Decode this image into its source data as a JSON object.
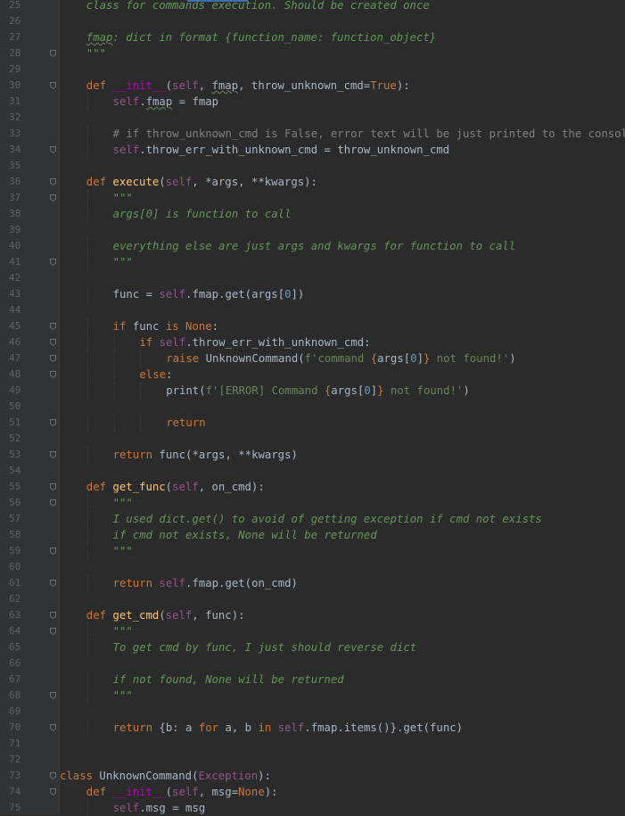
{
  "editor": {
    "language": "python",
    "colors": {
      "background": "#2b2b2b",
      "gutter": "#313335",
      "keyword": "#cc7832",
      "self": "#94558d",
      "function": "#ffc66d",
      "docstring": "#629755",
      "string": "#6a8759",
      "comment": "#808080",
      "text": "#a9b7c6"
    },
    "lines": [
      {
        "n": "25",
        "fold": false,
        "indent": 1,
        "tokens": [
          [
            "doc",
            "class for commands execution. Should be created once"
          ]
        ]
      },
      {
        "n": "26",
        "fold": false,
        "indent": 1,
        "tokens": []
      },
      {
        "n": "27",
        "fold": false,
        "indent": 1,
        "tokens": [
          [
            "docu",
            "fmap"
          ],
          [
            "doc",
            ": dict in format {function_name: function_object}"
          ]
        ]
      },
      {
        "n": "28",
        "fold": true,
        "indent": 1,
        "tokens": [
          [
            "doc",
            "\"\"\""
          ]
        ]
      },
      {
        "n": "29",
        "fold": false,
        "indent": 0,
        "tokens": []
      },
      {
        "n": "30",
        "fold": true,
        "indent": 1,
        "tokens": [
          [
            "kw",
            "def "
          ],
          [
            "magic",
            "__init__"
          ],
          [
            "t",
            "("
          ],
          [
            "self",
            "self"
          ],
          [
            "t",
            ", "
          ],
          [
            "tu",
            "fmap"
          ],
          [
            "t",
            ", throw_unknown_cmd="
          ],
          [
            "kw",
            "True"
          ],
          [
            "t",
            "):"
          ]
        ]
      },
      {
        "n": "31",
        "fold": false,
        "indent": 2,
        "tokens": [
          [
            "self",
            "self"
          ],
          [
            "t",
            "."
          ],
          [
            "tu",
            "fmap"
          ],
          [
            "t",
            " = fmap"
          ]
        ]
      },
      {
        "n": "32",
        "fold": false,
        "indent": 0,
        "tokens": []
      },
      {
        "n": "33",
        "fold": false,
        "indent": 2,
        "tokens": [
          [
            "cmt",
            "# if throw_unknown_cmd is False, error text will be just printed to the console"
          ]
        ]
      },
      {
        "n": "34",
        "fold": true,
        "indent": 2,
        "tokens": [
          [
            "self",
            "self"
          ],
          [
            "t",
            ".throw_err_with_unknown_cmd = throw_unknown_cmd"
          ]
        ]
      },
      {
        "n": "35",
        "fold": false,
        "indent": 0,
        "tokens": []
      },
      {
        "n": "36",
        "fold": true,
        "indent": 1,
        "tokens": [
          [
            "kw",
            "def "
          ],
          [
            "fn",
            "execute"
          ],
          [
            "t",
            "("
          ],
          [
            "self",
            "self"
          ],
          [
            "t",
            ", *args, **kwargs):"
          ]
        ]
      },
      {
        "n": "37",
        "fold": true,
        "indent": 2,
        "tokens": [
          [
            "doc",
            "\"\"\""
          ]
        ]
      },
      {
        "n": "38",
        "fold": false,
        "indent": 2,
        "tokens": [
          [
            "doc",
            "args[0] is function to call"
          ]
        ]
      },
      {
        "n": "39",
        "fold": false,
        "indent": 0,
        "tokens": []
      },
      {
        "n": "40",
        "fold": false,
        "indent": 2,
        "tokens": [
          [
            "doc",
            "everything else are just args and kwargs for function to call"
          ]
        ]
      },
      {
        "n": "41",
        "fold": true,
        "indent": 2,
        "tokens": [
          [
            "doc",
            "\"\"\""
          ]
        ]
      },
      {
        "n": "42",
        "fold": false,
        "indent": 0,
        "tokens": []
      },
      {
        "n": "43",
        "fold": false,
        "indent": 2,
        "tokens": [
          [
            "t",
            "func = "
          ],
          [
            "self",
            "self"
          ],
          [
            "t",
            ".fmap.get(args["
          ],
          [
            "num",
            "0"
          ],
          [
            "t",
            "])"
          ]
        ]
      },
      {
        "n": "44",
        "fold": false,
        "indent": 0,
        "tokens": []
      },
      {
        "n": "45",
        "fold": true,
        "indent": 2,
        "tokens": [
          [
            "kw",
            "if "
          ],
          [
            "t",
            "func "
          ],
          [
            "kw",
            "is None"
          ],
          [
            "t",
            ":"
          ]
        ]
      },
      {
        "n": "46",
        "fold": true,
        "indent": 3,
        "tokens": [
          [
            "kw",
            "if "
          ],
          [
            "self",
            "self"
          ],
          [
            "t",
            ".throw_err_with_unknown_cmd:"
          ]
        ]
      },
      {
        "n": "47",
        "fold": true,
        "indent": 4,
        "tokens": [
          [
            "kw",
            "raise "
          ],
          [
            "t",
            "UnknownCommand("
          ],
          [
            "str",
            "f'command "
          ],
          [
            "kw",
            "{"
          ],
          [
            "t",
            "args["
          ],
          [
            "num",
            "0"
          ],
          [
            "t",
            "]"
          ],
          [
            "kw",
            "}"
          ],
          [
            "str",
            " not found!'"
          ],
          [
            "t",
            ")"
          ]
        ]
      },
      {
        "n": "48",
        "fold": true,
        "indent": 3,
        "tokens": [
          [
            "kw",
            "else"
          ],
          [
            "t",
            ":"
          ]
        ]
      },
      {
        "n": "49",
        "fold": false,
        "indent": 4,
        "tokens": [
          [
            "t",
            "print("
          ],
          [
            "str",
            "f'[ERROR] Command "
          ],
          [
            "kw",
            "{"
          ],
          [
            "t",
            "args["
          ],
          [
            "num",
            "0"
          ],
          [
            "t",
            "]"
          ],
          [
            "kw",
            "}"
          ],
          [
            "str",
            " not found!'"
          ],
          [
            "t",
            ")"
          ]
        ]
      },
      {
        "n": "50",
        "fold": false,
        "indent": 0,
        "tokens": []
      },
      {
        "n": "51",
        "fold": true,
        "indent": 4,
        "tokens": [
          [
            "kw",
            "return"
          ]
        ]
      },
      {
        "n": "52",
        "fold": false,
        "indent": 0,
        "tokens": []
      },
      {
        "n": "53",
        "fold": true,
        "indent": 2,
        "tokens": [
          [
            "kw",
            "return "
          ],
          [
            "t",
            "func(*args, **kwargs)"
          ]
        ]
      },
      {
        "n": "54",
        "fold": false,
        "indent": 0,
        "tokens": []
      },
      {
        "n": "55",
        "fold": true,
        "indent": 1,
        "tokens": [
          [
            "kw",
            "def "
          ],
          [
            "fn",
            "get_func"
          ],
          [
            "t",
            "("
          ],
          [
            "self",
            "self"
          ],
          [
            "t",
            ", on_cmd):"
          ]
        ]
      },
      {
        "n": "56",
        "fold": true,
        "indent": 2,
        "tokens": [
          [
            "doc",
            "\"\"\""
          ]
        ]
      },
      {
        "n": "57",
        "fold": false,
        "indent": 2,
        "tokens": [
          [
            "doc",
            "I used dict.get() to avoid of getting exception if cmd not exists"
          ]
        ]
      },
      {
        "n": "58",
        "fold": false,
        "indent": 2,
        "tokens": [
          [
            "doc",
            "if cmd not exists, None will be returned"
          ]
        ]
      },
      {
        "n": "59",
        "fold": true,
        "indent": 2,
        "tokens": [
          [
            "doc",
            "\"\"\""
          ]
        ]
      },
      {
        "n": "60",
        "fold": false,
        "indent": 0,
        "tokens": []
      },
      {
        "n": "61",
        "fold": true,
        "indent": 2,
        "tokens": [
          [
            "kw",
            "return "
          ],
          [
            "self",
            "self"
          ],
          [
            "t",
            ".fmap.get(on_cmd)"
          ]
        ]
      },
      {
        "n": "62",
        "fold": false,
        "indent": 0,
        "tokens": []
      },
      {
        "n": "63",
        "fold": true,
        "indent": 1,
        "tokens": [
          [
            "kw",
            "def "
          ],
          [
            "fn",
            "get_cmd"
          ],
          [
            "t",
            "("
          ],
          [
            "self",
            "self"
          ],
          [
            "t",
            ", func):"
          ]
        ]
      },
      {
        "n": "64",
        "fold": true,
        "indent": 2,
        "tokens": [
          [
            "doc",
            "\"\"\""
          ]
        ]
      },
      {
        "n": "65",
        "fold": false,
        "indent": 2,
        "tokens": [
          [
            "doc",
            "To get cmd by func, I just should reverse dict"
          ]
        ]
      },
      {
        "n": "66",
        "fold": false,
        "indent": 0,
        "tokens": []
      },
      {
        "n": "67",
        "fold": false,
        "indent": 2,
        "tokens": [
          [
            "doc",
            "if not found, None will be returned"
          ]
        ]
      },
      {
        "n": "68",
        "fold": true,
        "indent": 2,
        "tokens": [
          [
            "doc",
            "\"\"\""
          ]
        ]
      },
      {
        "n": "69",
        "fold": false,
        "indent": 0,
        "tokens": []
      },
      {
        "n": "70",
        "fold": true,
        "indent": 2,
        "tokens": [
          [
            "kw",
            "return "
          ],
          [
            "t",
            "{b: a "
          ],
          [
            "kw",
            "for "
          ],
          [
            "t",
            "a, b "
          ],
          [
            "kw",
            "in "
          ],
          [
            "self",
            "self"
          ],
          [
            "t",
            ".fmap.items()}.get(func)"
          ]
        ]
      },
      {
        "n": "71",
        "fold": false,
        "indent": 0,
        "tokens": []
      },
      {
        "n": "72",
        "fold": false,
        "indent": 0,
        "tokens": []
      },
      {
        "n": "73",
        "fold": true,
        "indent": 0,
        "tokens": [
          [
            "kw",
            "class "
          ],
          [
            "t",
            "UnknownCommand("
          ],
          [
            "self",
            "Exception"
          ],
          [
            "t",
            "):"
          ]
        ]
      },
      {
        "n": "74",
        "fold": true,
        "indent": 1,
        "tokens": [
          [
            "kw",
            "def "
          ],
          [
            "magic",
            "__init__"
          ],
          [
            "t",
            "("
          ],
          [
            "self",
            "self"
          ],
          [
            "t",
            ", msg="
          ],
          [
            "kw",
            "None"
          ],
          [
            "t",
            "):"
          ]
        ]
      },
      {
        "n": "75",
        "fold": false,
        "indent": 2,
        "tokens": [
          [
            "self",
            "self"
          ],
          [
            "t",
            ".msg = msg"
          ]
        ]
      }
    ]
  }
}
